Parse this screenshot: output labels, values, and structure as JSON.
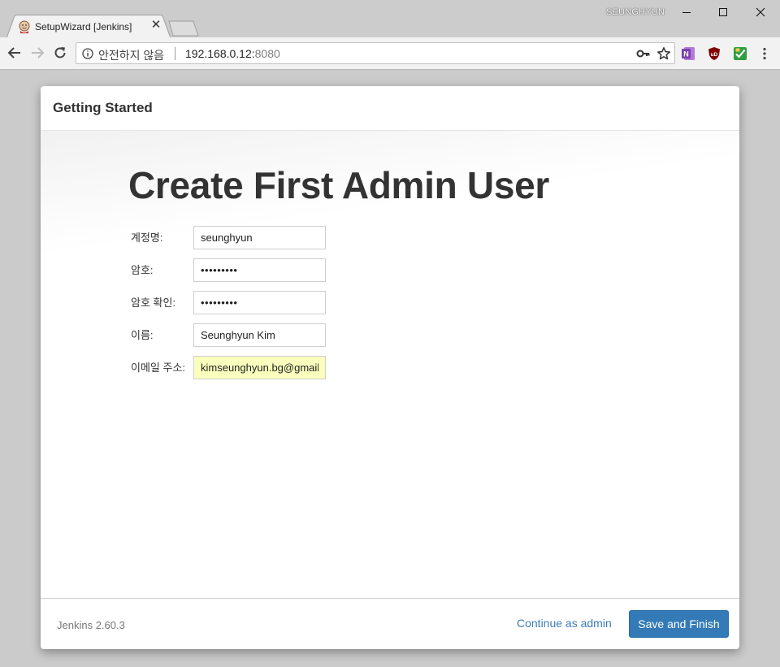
{
  "browser": {
    "tab": {
      "title": "SetupWizard [Jenkins]",
      "close_glyph": "✕",
      "favicon": "jenkins-butler-icon"
    },
    "profile_name": "SEUNGHYUN",
    "address_bar": {
      "security_label": "안전하지 않음",
      "host": "192.168.0.12:",
      "port": "8080"
    },
    "extensions": [
      {
        "name": "onenote-extension-icon",
        "color": "#7b3fb0",
        "glyph": "N"
      },
      {
        "name": "ublock-extension-icon",
        "color": "#800000",
        "glyph": "uD"
      },
      {
        "name": "green-extension-icon",
        "color": "#2e9e3e",
        "glyph": "✓"
      }
    ]
  },
  "dialog": {
    "header_title": "Getting Started",
    "heading": "Create First Admin User",
    "fields": [
      {
        "label": "계정명:",
        "value": "seunghyun",
        "type": "text"
      },
      {
        "label": "암호:",
        "value": "•••••••••",
        "type": "password"
      },
      {
        "label": "암호 확인:",
        "value": "•••••••••",
        "type": "password"
      },
      {
        "label": "이름:",
        "value": "Seunghyun Kim",
        "type": "text"
      },
      {
        "label": "이메일 주소:",
        "value": "kimseunghyun.bg@gmail",
        "type": "email",
        "autofilled": true
      }
    ],
    "footer": {
      "version": "Jenkins 2.60.3",
      "continue_label": "Continue as admin",
      "save_label": "Save and Finish"
    }
  },
  "colors": {
    "primary_button": "#337ab7",
    "link": "#3d7cb8",
    "autofill": "#faffbd"
  }
}
